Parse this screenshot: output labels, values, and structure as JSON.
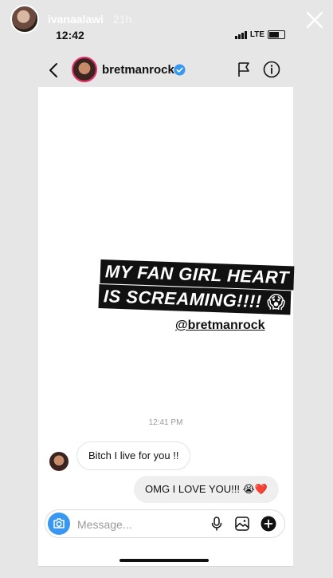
{
  "story": {
    "username": "ivanaalawi",
    "posted_ago": "21h"
  },
  "status_bar": {
    "time": "12:42",
    "network": "LTE"
  },
  "chat": {
    "username": "bretmanrock",
    "verified": true
  },
  "sticker": {
    "line1": "MY FAN GIRL HEART",
    "line2": "IS SCREAMING!!!! 😱",
    "mention": "@bretmanrock"
  },
  "messages": {
    "timestamp": "12:41 PM",
    "incoming": "Bitch I live for you !!",
    "outgoing": "OMG I LOVE YOU!!! 😭❤️"
  },
  "composer": {
    "placeholder": "Message..."
  },
  "colors": {
    "accent_blue": "#3897f0",
    "story_ring": "#e1306c",
    "bubble_out_bg": "#efefef"
  },
  "icons": [
    "close-icon",
    "back-icon",
    "verified-badge-icon",
    "flag-icon",
    "info-icon",
    "camera-icon",
    "microphone-icon",
    "gallery-icon",
    "plus-icon"
  ]
}
